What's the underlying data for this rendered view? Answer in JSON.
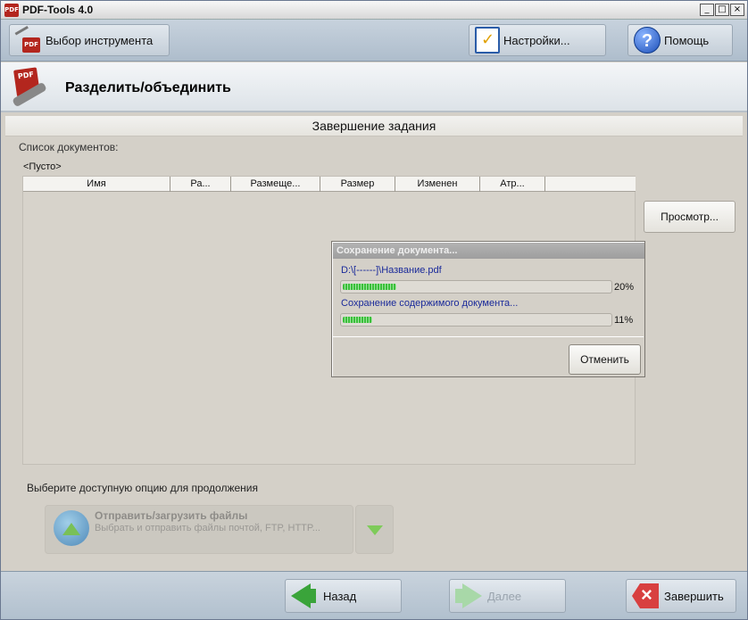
{
  "window": {
    "title": "PDF-Tools 4.0",
    "icon": "pdf-app-icon",
    "controls": [
      "_",
      "□",
      "×"
    ]
  },
  "toolbar": {
    "tool_select_label": "Выбор инструмента",
    "settings_label": "Настройки...",
    "help_label": "Помощь"
  },
  "header": {
    "title": "Разделить/объединить"
  },
  "stage": {
    "title": "Завершение задания"
  },
  "documents": {
    "list_label": "Список документов:",
    "empty_label": "<Пусто>",
    "columns": [
      "Имя",
      "Ра...",
      "Размеще...",
      "Размер",
      "Изменен",
      "Атр..."
    ],
    "rows": []
  },
  "preview_label": "Просмотр...",
  "progress_dialog": {
    "title": "Сохранение документа...",
    "file_path": "D:\\[------]\\Название.pdf",
    "file_progress": 0.2,
    "file_percent": "20%",
    "content_status": "Сохранение содержимого документа...",
    "content_progress": 0.11,
    "content_percent": "11%",
    "cancel_label": "Отменить"
  },
  "options": {
    "label": "Выберите доступную опцию для продолжения",
    "send_title": "Отправить/загрузить файлы",
    "send_description": "Выбрать и отправить файлы почтой, FTP, HTTP..."
  },
  "footer": {
    "back_label": "Назад",
    "next_label": "Далее",
    "finish_label": "Завершить"
  },
  "colors": {
    "toolbar_bg": "#b9c6d3",
    "dialog_title_bg": "#a8a8a8",
    "progress_green": "#3bbf3b",
    "link_text": "#1a2a9a"
  }
}
